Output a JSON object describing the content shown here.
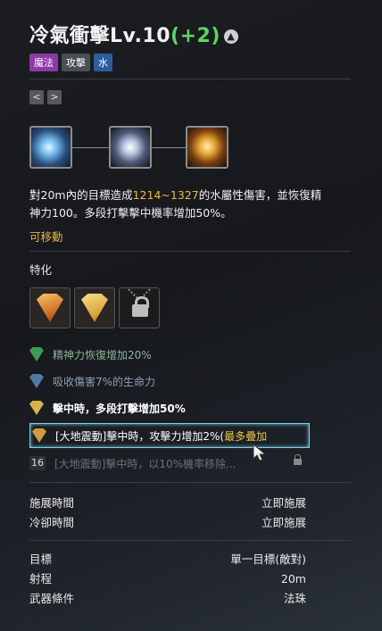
{
  "skill": {
    "name": "冷氣衝擊Lv.10",
    "bonus": "(+2)",
    "tags": [
      "魔法",
      "攻擊",
      "水"
    ],
    "nav_prev": "<",
    "nav_next": ">",
    "description_parts": [
      "對20m內的目標造成",
      "1214~1327",
      "的水屬性傷害，並恢復精神力100。多段打擊擊中機率增加50%。"
    ],
    "movable": "可移動"
  },
  "specialization": {
    "title": "特化",
    "options": [
      {
        "text": "精神力恢復增加20%"
      },
      {
        "text": "吸收傷害7%的生命力"
      },
      {
        "text": "擊中時，多段打擊增加50%"
      },
      {
        "text": "[大地震動]擊中時，攻擊力增加2%(",
        "max": "最多疊加"
      },
      {
        "level": "16",
        "text": "[大地震動]擊中時，以10%機率移除..."
      }
    ]
  },
  "timing": {
    "cast_label": "施展時間",
    "cast_value": "立即施展",
    "cooldown_label": "冷卻時間",
    "cooldown_value": "立即施展"
  },
  "targeting": {
    "target_label": "目標",
    "target_value": "單一目標(敵對)",
    "range_label": "射程",
    "range_value": "20m",
    "weapon_label": "武器條件",
    "weapon_value": "法珠"
  }
}
